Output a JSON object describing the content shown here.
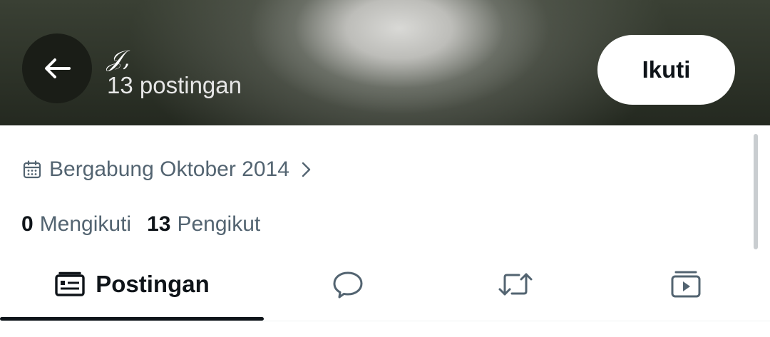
{
  "header": {
    "title": "𝒥,",
    "post_count": "13 postingan",
    "back_icon": "arrow-left-icon",
    "follow_label": "Ikuti"
  },
  "profile": {
    "joined": "Bergabung Oktober 2014",
    "calendar_icon": "calendar-icon",
    "chevron_icon": "chevron-right-icon",
    "following_count": "0",
    "following_label": "Mengikuti",
    "followers_count": "13",
    "followers_label": "Pengikut"
  },
  "tabs": [
    {
      "label": "Postingan",
      "icon": "posts-icon",
      "active": true
    },
    {
      "label": "",
      "icon": "replies-icon",
      "active": false
    },
    {
      "label": "",
      "icon": "repost-icon",
      "active": false
    },
    {
      "label": "",
      "icon": "media-icon",
      "active": false
    }
  ],
  "colors": {
    "text_primary": "#0f1419",
    "text_secondary": "#536471",
    "header_bg": "#2b3127"
  }
}
